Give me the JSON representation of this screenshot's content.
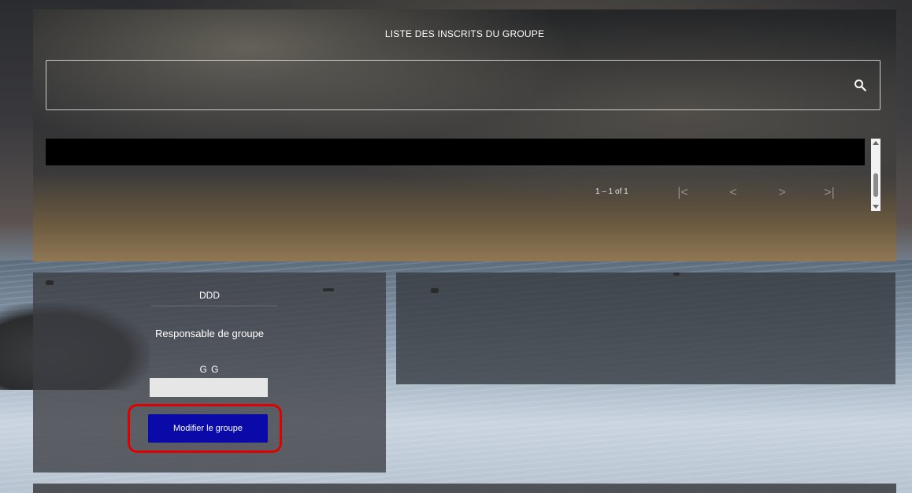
{
  "header": {
    "title": "LISTE DES INSCRITS DU GROUPE"
  },
  "search": {
    "value": "",
    "placeholder": "",
    "icon": "search-icon"
  },
  "paginator": {
    "range_label": "1 – 1 of 1",
    "first": "|<",
    "prev": "<",
    "next": ">",
    "last": ">|"
  },
  "group_card": {
    "name": "DDD",
    "role": "Responsable de groupe",
    "initials": "G G",
    "modify_button": "Modifier le groupe"
  },
  "colors": {
    "button": "#0a0aa8",
    "highlight": "#e10000",
    "table_header": "#000000"
  }
}
